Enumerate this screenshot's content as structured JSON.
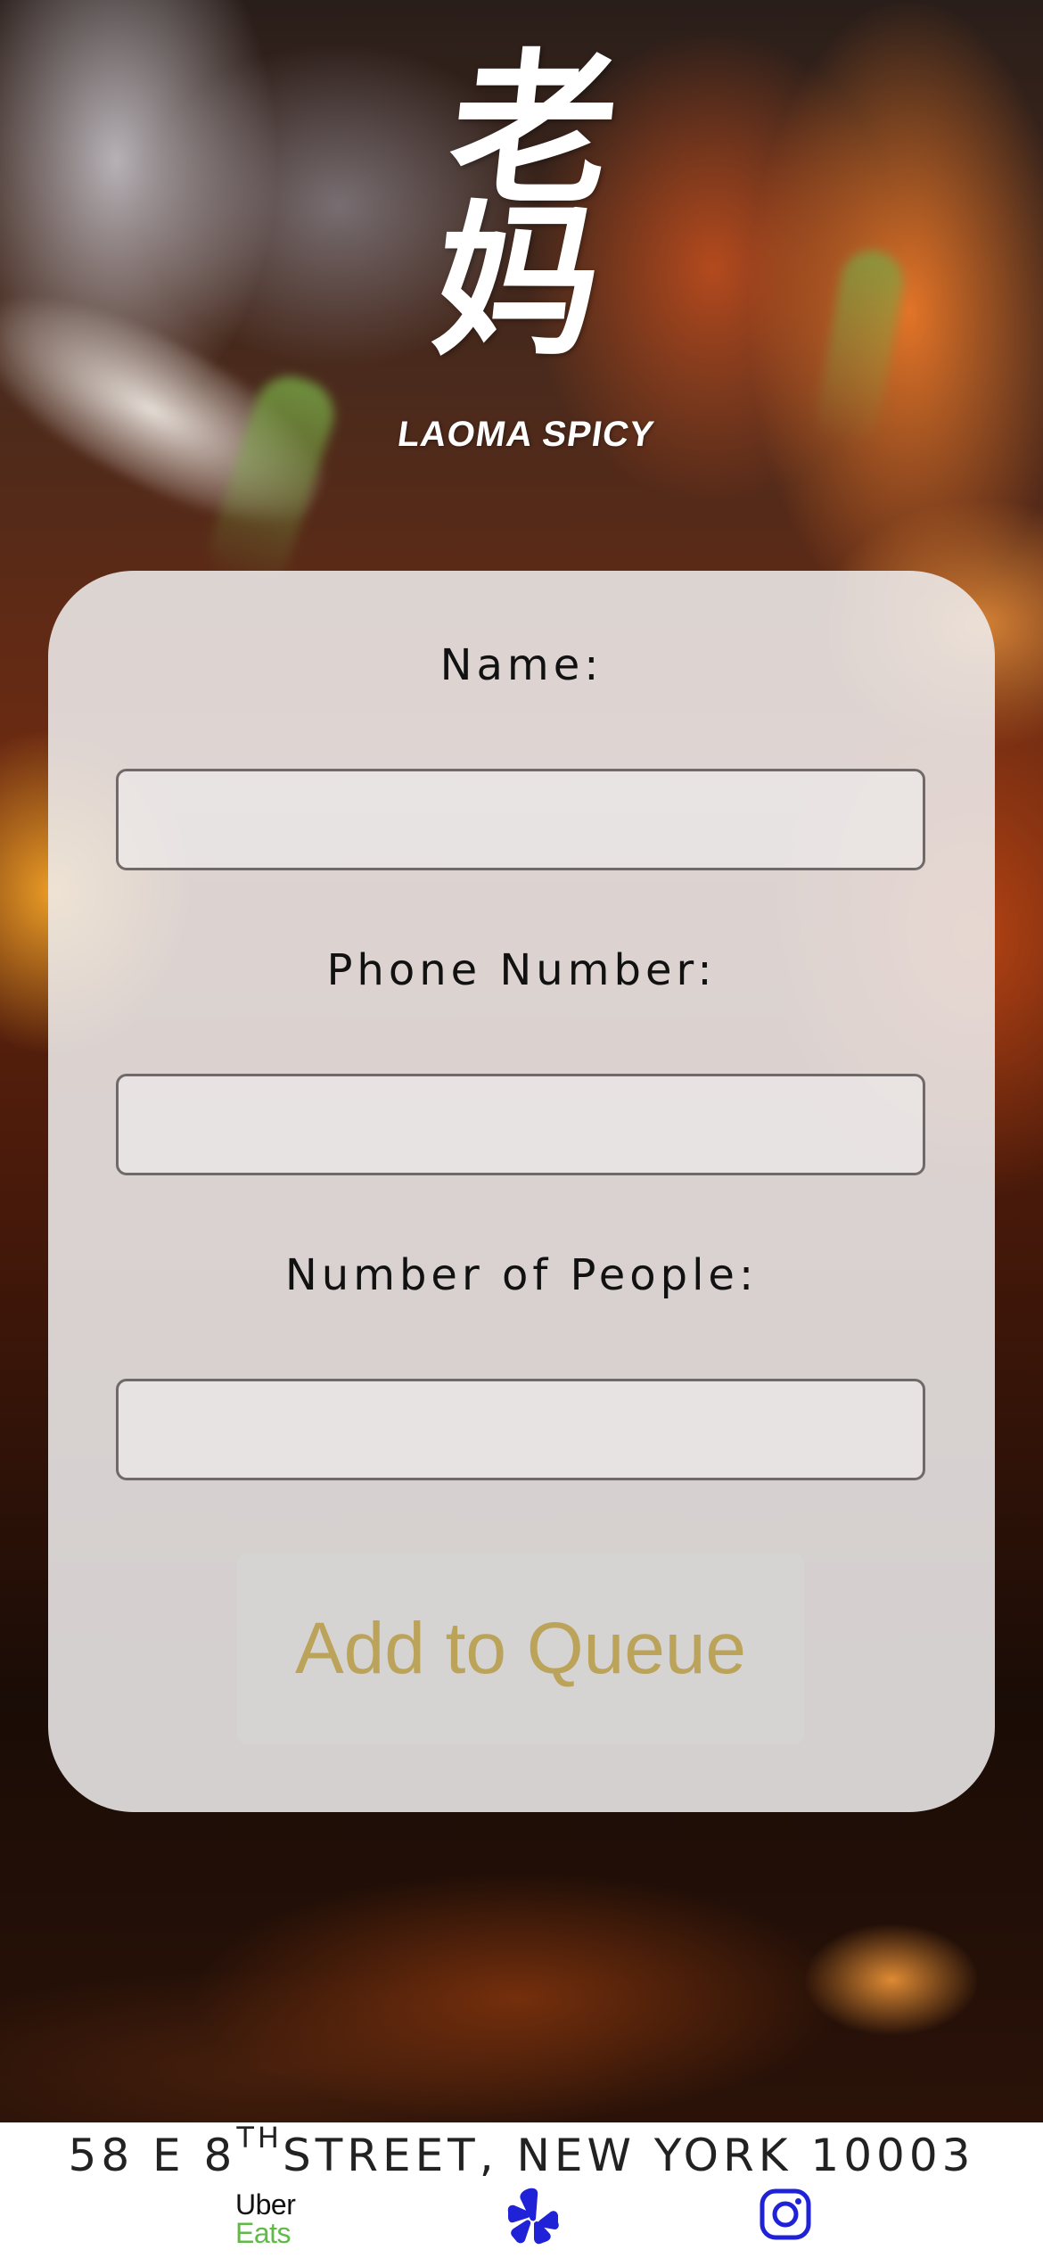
{
  "logo": {
    "glyphs": "老妈",
    "subtitle": "LAOMA SPICY"
  },
  "form": {
    "fields": [
      {
        "label": "Name:",
        "value": "",
        "placeholder": ""
      },
      {
        "label": "Phone Number:",
        "value": "",
        "placeholder": ""
      },
      {
        "label": "Number of People:",
        "value": "",
        "placeholder": ""
      }
    ],
    "submit_label": "Add to Queue"
  },
  "footer": {
    "address_prefix": "58 E 8",
    "address_sup": "TH",
    "address_suffix": "STREET, NEW YORK 10003",
    "links": [
      {
        "icon": "uber-eats-icon",
        "line1": "Uber",
        "line2": "Eats"
      },
      {
        "icon": "yelp-icon"
      },
      {
        "icon": "instagram-icon"
      }
    ]
  },
  "colors": {
    "button_text": "#bba35a",
    "uber_green": "#5fbb46",
    "yelp_blue": "#1f22d6",
    "instagram_blue": "#1f22d6"
  }
}
